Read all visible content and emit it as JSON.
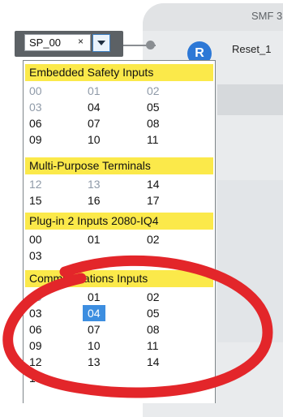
{
  "canvas": {
    "block_title": "SMF 3",
    "reset_badge": "R",
    "reset_label": "Reset_1"
  },
  "selector": {
    "value": "SP_00",
    "clear_symbol": "×",
    "dropdown_icon": "chevron-down-icon"
  },
  "sections": [
    {
      "title": "Embedded Safety Inputs",
      "rows": [
        [
          {
            "label": "00",
            "enabled": false
          },
          {
            "label": "01",
            "enabled": false
          },
          {
            "label": "02",
            "enabled": false
          }
        ],
        [
          {
            "label": "03",
            "enabled": false
          },
          {
            "label": "04",
            "enabled": true
          },
          {
            "label": "05",
            "enabled": true
          }
        ],
        [
          {
            "label": "06",
            "enabled": true
          },
          {
            "label": "07",
            "enabled": true
          },
          {
            "label": "08",
            "enabled": true
          }
        ],
        [
          {
            "label": "09",
            "enabled": true
          },
          {
            "label": "10",
            "enabled": true
          },
          {
            "label": "11",
            "enabled": true
          }
        ]
      ]
    },
    {
      "title": "Multi-Purpose Terminals",
      "rows": [
        [
          {
            "label": "12",
            "enabled": false
          },
          {
            "label": "13",
            "enabled": false
          },
          {
            "label": "14",
            "enabled": true
          }
        ],
        [
          {
            "label": "15",
            "enabled": true
          },
          {
            "label": "16",
            "enabled": true
          },
          {
            "label": "17",
            "enabled": true
          }
        ]
      ]
    },
    {
      "title": "Plug-in 2 Inputs 2080-IQ4",
      "rows": [
        [
          {
            "label": "00",
            "enabled": true
          },
          {
            "label": "01",
            "enabled": true
          },
          {
            "label": "02",
            "enabled": true
          }
        ],
        [
          {
            "label": "03",
            "enabled": true
          }
        ]
      ]
    },
    {
      "title": "Communications Inputs",
      "rows": [
        [
          {
            "label": "00",
            "enabled": false
          },
          {
            "label": "01",
            "enabled": true
          },
          {
            "label": "02",
            "enabled": true
          }
        ],
        [
          {
            "label": "03",
            "enabled": true
          },
          {
            "label": "04",
            "enabled": true,
            "selected": true
          },
          {
            "label": "05",
            "enabled": true
          }
        ],
        [
          {
            "label": "06",
            "enabled": true
          },
          {
            "label": "07",
            "enabled": true
          },
          {
            "label": "08",
            "enabled": true
          }
        ],
        [
          {
            "label": "09",
            "enabled": true
          },
          {
            "label": "10",
            "enabled": true
          },
          {
            "label": "11",
            "enabled": true
          }
        ],
        [
          {
            "label": "12",
            "enabled": true
          },
          {
            "label": "13",
            "enabled": true
          },
          {
            "label": "14",
            "enabled": true
          }
        ],
        [
          {
            "label": "15",
            "enabled": true
          }
        ]
      ]
    }
  ],
  "colors": {
    "section_header": "#fbe94a",
    "selection": "#3d8ee0",
    "disabled_text": "#8f9aa8",
    "annotation_ring": "#e3262a",
    "badge": "#2d78d6"
  }
}
